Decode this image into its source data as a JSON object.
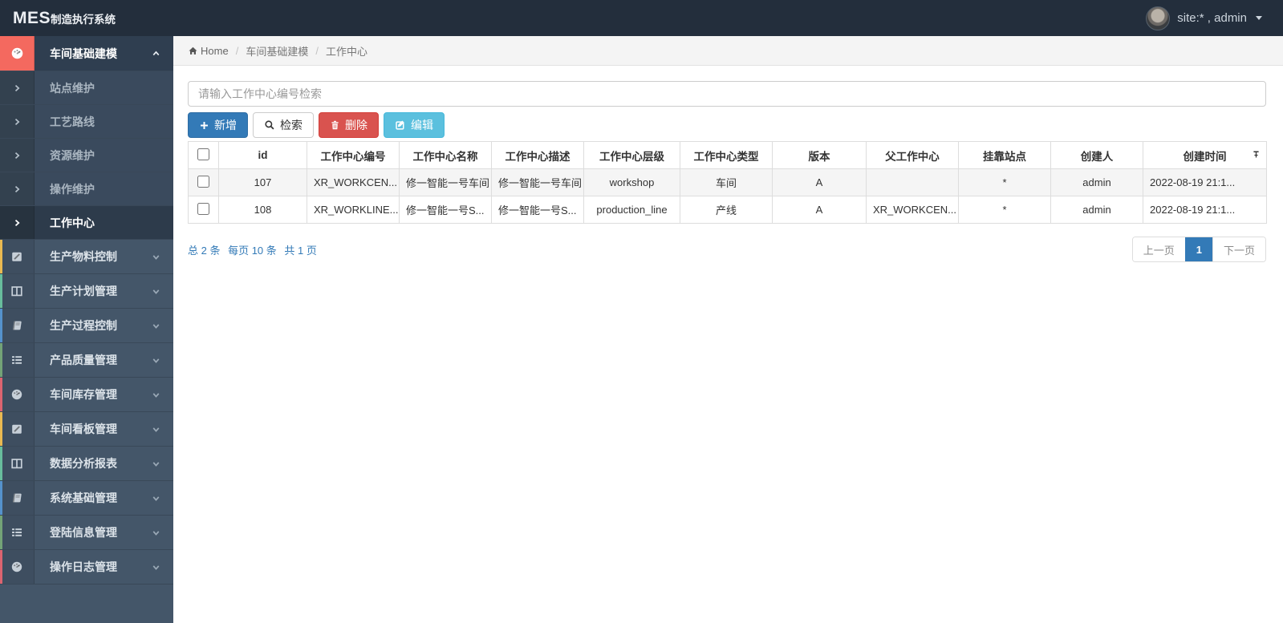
{
  "navbar": {
    "brand_big": "MES",
    "brand_small": "制造执行系统",
    "user_label": "site:* , admin"
  },
  "breadcrumb": {
    "home": "Home",
    "level1": "车间基础建模",
    "level2": "工作中心"
  },
  "sidebar": {
    "groups": [
      {
        "label": "车间基础建模",
        "icon": "dashboard-icon",
        "active": true
      },
      {
        "label": "生产物料控制",
        "icon": "pencil-square-icon",
        "strip": "#e9b951"
      },
      {
        "label": "生产计划管理",
        "icon": "columns-icon",
        "strip": "#68bd9c"
      },
      {
        "label": "生产过程控制",
        "icon": "book-icon",
        "strip": "#5592cc"
      },
      {
        "label": "产品质量管理",
        "icon": "list-icon",
        "strip": "#73a377"
      },
      {
        "label": "车间库存管理",
        "icon": "dashboard-icon",
        "strip": "#dc6470"
      },
      {
        "label": "车间看板管理",
        "icon": "pencil-square-icon",
        "strip": "#e9b951"
      },
      {
        "label": "数据分析报表",
        "icon": "columns-icon",
        "strip": "#68bd9c"
      },
      {
        "label": "系统基础管理",
        "icon": "book-icon",
        "strip": "#5592cc"
      },
      {
        "label": "登陆信息管理",
        "icon": "list-icon",
        "strip": "#73a377"
      },
      {
        "label": "操作日志管理",
        "icon": "dashboard-icon",
        "strip": "#dc6470"
      }
    ],
    "submenu": [
      {
        "label": "站点维护"
      },
      {
        "label": "工艺路线"
      },
      {
        "label": "资源维护"
      },
      {
        "label": "操作维护"
      },
      {
        "label": "工作中心",
        "active": true
      }
    ]
  },
  "search": {
    "placeholder": "请输入工作中心编号检索",
    "value": ""
  },
  "toolbar": {
    "add_label": "新增",
    "search_label": "检索",
    "delete_label": "删除",
    "edit_label": "编辑"
  },
  "table": {
    "columns": [
      "id",
      "工作中心编号",
      "工作中心名称",
      "工作中心描述",
      "工作中心层级",
      "工作中心类型",
      "版本",
      "父工作中心",
      "挂靠站点",
      "创建人",
      "创建时间"
    ],
    "rows": [
      [
        "107",
        "XR_WORKCEN...",
        "修一智能一号车间",
        "修一智能一号车间",
        "workshop",
        "车间",
        "A",
        "",
        "*",
        "admin",
        "2022-08-19 21:1..."
      ],
      [
        "108",
        "XR_WORKLINE...",
        "修一智能一号S...",
        "修一智能一号S...",
        "production_line",
        "产线",
        "A",
        "XR_WORKCEN...",
        "*",
        "admin",
        "2022-08-19 21:1..."
      ]
    ]
  },
  "pagination": {
    "total": "总 2 条",
    "per_page": "每页 10 条",
    "pages": "共 1 页",
    "prev": "上一页",
    "page": "1",
    "next": "下一页"
  },
  "colors": {
    "accent": "#337ab7",
    "danger": "#d9534f",
    "info": "#5bc0de",
    "active_icon_bg": "#f4695f",
    "navbar_bg": "#232e3c",
    "sidebar_bg": "#445669"
  }
}
